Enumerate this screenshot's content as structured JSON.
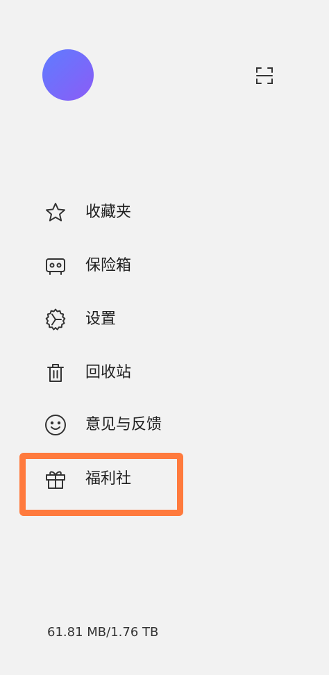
{
  "header": {
    "avatar_colors": [
      "#5f7cff",
      "#8b5cf6"
    ],
    "scan_icon": "scan-icon"
  },
  "menu": {
    "items": [
      {
        "label": "收藏夹",
        "icon": "star-icon"
      },
      {
        "label": "保险箱",
        "icon": "safe-icon"
      },
      {
        "label": "设置",
        "icon": "gear-icon"
      },
      {
        "label": "回收站",
        "icon": "trash-icon"
      },
      {
        "label": "意见与反馈",
        "icon": "smiley-icon"
      },
      {
        "label": "福利社",
        "icon": "gift-icon"
      }
    ]
  },
  "highlight_color": "#ff7a3d",
  "footer": {
    "storage": "61.81 MB/1.76 TB"
  }
}
